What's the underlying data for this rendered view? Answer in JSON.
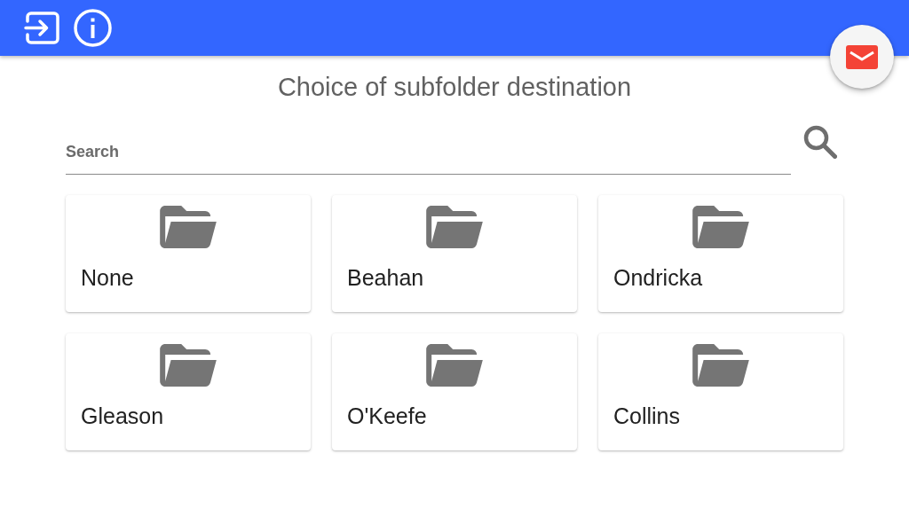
{
  "title": "Choice of subfolder destination",
  "search": {
    "placeholder": "Search"
  },
  "folders": [
    {
      "name": "None"
    },
    {
      "name": "Beahan"
    },
    {
      "name": "Ondricka"
    },
    {
      "name": "Gleason"
    },
    {
      "name": "O'Keefe"
    },
    {
      "name": "Collins"
    }
  ]
}
